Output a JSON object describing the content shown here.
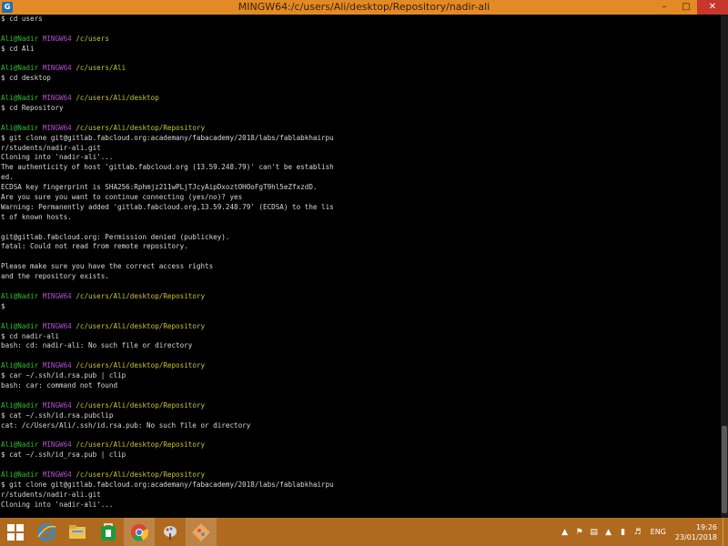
{
  "window": {
    "title": "MINGW64:/c/users/Ali/desktop/Repository/nadir-ali",
    "icon": "git-bash-icon",
    "controls": {
      "minimize": "–",
      "maximize": "□",
      "close": "✕"
    }
  },
  "colors": {
    "titlebar": "#e38a26",
    "prompt_user": "#2fbf2f",
    "prompt_host": "#b64bd1",
    "prompt_path": "#c7c72e",
    "text": "#d8d8d8",
    "background": "#000000",
    "taskbar": "#b06a1f"
  },
  "terminal": {
    "lines": [
      {
        "type": "text",
        "text": "$ cd users"
      },
      {
        "type": "blank"
      },
      {
        "type": "prompt",
        "user": "Ali@Nadir",
        "host": "MINGW64",
        "path": "/c/users"
      },
      {
        "type": "text",
        "text": "$ cd Ali"
      },
      {
        "type": "blank"
      },
      {
        "type": "prompt",
        "user": "Ali@Nadir",
        "host": "MINGW64",
        "path": "/c/users/Ali"
      },
      {
        "type": "text",
        "text": "$ cd desktop"
      },
      {
        "type": "blank"
      },
      {
        "type": "prompt",
        "user": "Ali@Nadir",
        "host": "MINGW64",
        "path": "/c/users/Ali/desktop"
      },
      {
        "type": "text",
        "text": "$ cd Repository"
      },
      {
        "type": "blank"
      },
      {
        "type": "prompt",
        "user": "Ali@Nadir",
        "host": "MINGW64",
        "path": "/c/users/Ali/desktop/Repository"
      },
      {
        "type": "text",
        "text": "$ git clone git@gitlab.fabcloud.org:academany/fabacademy/2018/labs/fablabkhairpu"
      },
      {
        "type": "text",
        "text": "r/students/nadir-ali.git"
      },
      {
        "type": "text",
        "text": "Cloning into 'nadir-ali'..."
      },
      {
        "type": "text",
        "text": "The authenticity of host 'gitlab.fabcloud.org (13.59.248.79)' can't be establish"
      },
      {
        "type": "text",
        "text": "ed."
      },
      {
        "type": "text",
        "text": "ECDSA key fingerprint is SHA256:Rphmjz211wPLjTJcyAipDxoztOHOoFgT9hl5eZfxzdD."
      },
      {
        "type": "text",
        "text": "Are you sure you want to continue connecting (yes/no)? yes"
      },
      {
        "type": "text",
        "text": "Warning: Permanently added 'gitlab.fabcloud.org,13.59.248.79' (ECDSA) to the lis"
      },
      {
        "type": "text",
        "text": "t of known hosts."
      },
      {
        "type": "blank"
      },
      {
        "type": "text",
        "text": "git@gitlab.fabcloud.org: Permission denied (publickey)."
      },
      {
        "type": "text",
        "text": "fatal: Could not read from remote repository."
      },
      {
        "type": "blank"
      },
      {
        "type": "text",
        "text": "Please make sure you have the correct access rights"
      },
      {
        "type": "text",
        "text": "and the repository exists."
      },
      {
        "type": "blank"
      },
      {
        "type": "prompt",
        "user": "Ali@Nadir",
        "host": "MINGW64",
        "path": "/c/users/Ali/desktop/Repository"
      },
      {
        "type": "text",
        "text": "$"
      },
      {
        "type": "blank"
      },
      {
        "type": "prompt",
        "user": "Ali@Nadir",
        "host": "MINGW64",
        "path": "/c/users/Ali/desktop/Repository"
      },
      {
        "type": "text",
        "text": "$ cd nadir-ali"
      },
      {
        "type": "text",
        "text": "bash: cd: nadir-ali: No such file or directory"
      },
      {
        "type": "blank"
      },
      {
        "type": "prompt",
        "user": "Ali@Nadir",
        "host": "MINGW64",
        "path": "/c/users/Ali/desktop/Repository"
      },
      {
        "type": "text",
        "text": "$ car ~/.ssh/id.rsa.pub | clip"
      },
      {
        "type": "text",
        "text": "bash: car: command not found"
      },
      {
        "type": "blank"
      },
      {
        "type": "prompt",
        "user": "Ali@Nadir",
        "host": "MINGW64",
        "path": "/c/users/Ali/desktop/Repository"
      },
      {
        "type": "text",
        "text": "$ cat ~/.ssh/id.rsa.pubclip"
      },
      {
        "type": "text",
        "text": "cat: /c/Users/Ali/.ssh/id.rsa.pub: No such file or directory"
      },
      {
        "type": "blank"
      },
      {
        "type": "prompt",
        "user": "Ali@Nadir",
        "host": "MINGW64",
        "path": "/c/users/Ali/desktop/Repository"
      },
      {
        "type": "text",
        "text": "$ cat ~/.ssh/id_rsa.pub | clip"
      },
      {
        "type": "blank"
      },
      {
        "type": "prompt",
        "user": "Ali@Nadir",
        "host": "MINGW64",
        "path": "/c/users/Ali/desktop/Repository"
      },
      {
        "type": "text",
        "text": "$ git clone git@gitlab.fabcloud.org:academany/fabacademy/2018/labs/fablabkhairpu"
      },
      {
        "type": "text",
        "text": "r/students/nadir-ali.git"
      },
      {
        "type": "text",
        "text": "Cloning into 'nadir-ali'..."
      }
    ]
  },
  "taskbar": {
    "items": [
      {
        "name": "start-button",
        "icon": "windows-logo-icon"
      },
      {
        "name": "taskbar-internet-explorer",
        "icon": "internet-explorer-icon",
        "color": "#2a8fd6"
      },
      {
        "name": "taskbar-file-explorer",
        "icon": "folder-icon",
        "color": "#e9c25a"
      },
      {
        "name": "taskbar-store",
        "icon": "store-icon",
        "color": "#1c9a3a"
      },
      {
        "name": "taskbar-chrome",
        "icon": "chrome-icon",
        "color": "#e0432f"
      },
      {
        "name": "taskbar-paint",
        "icon": "paint-icon",
        "color": "#d8d8d8"
      },
      {
        "name": "taskbar-git-bash",
        "icon": "git-bash-icon",
        "color": "#e38a26"
      }
    ],
    "tray": {
      "language": "ENG",
      "time": "19:26",
      "date": "23/01/2018"
    }
  }
}
